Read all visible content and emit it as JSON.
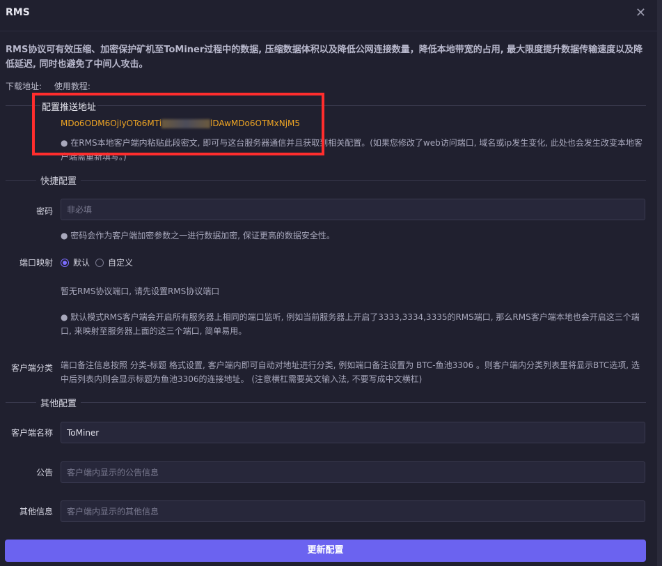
{
  "header": {
    "title": "RMS",
    "close_icon": "close-icon"
  },
  "description": "RMS协议可有效压缩、加密保护矿机至ToMiner过程中的数据, 压缩数据体积以及降低公网连接数量，降低本地带宽的占用, 最大限度提升数据传输速度以及降低延迟, 同时也避免了中间人攻击。",
  "links": {
    "download": "下载地址:",
    "tutorial": "使用教程:"
  },
  "push": {
    "title": "配置推送地址",
    "address_start": "MDo6ODM6OjIyOTo6MTi",
    "address_end": "lDAwMDo6OTMxNjM5",
    "note": "● 在RMS本地客户端内粘贴此段密文, 即可与这台服务器通信并且获取到相关配置。(如果您修改了web访问端口, 域名或ip发生变化, 此处也会发生改变本地客户端需重新填写。)"
  },
  "quick": {
    "title": "快捷配置",
    "password_label": "密码",
    "password_placeholder": "非必填",
    "password_note": "● 密码会作为客户端加密参数之一进行数据加密, 保证更高的数据安全性。",
    "port_label": "端口映射",
    "port_options": [
      "默认",
      "自定义"
    ],
    "port_empty": "暂无RMS协议端口, 请先设置RMS协议端口",
    "port_note": "● 默认模式RMS客户端会开启所有服务器上相同的端口监听, 例如当前服务器上开启了3333,3334,3335的RMS端口, 那么RMS客户端本地也会开启这三个端口, 来映射至服务器上面的这三个端口, 简单易用。",
    "client_category_label": "客户端分类",
    "client_category_note": "端口备注信息按照 分类-标题 格式设置, 客户端内即可自动对地址进行分类, 例如端口备注设置为 BTC-鱼池3306 。则客户端内分类列表里将显示BTC选项, 选中后列表内则会显示标题为鱼池3306的连接地址。 (注意横杠需要英文输入法, 不要写成中文横杠)"
  },
  "other": {
    "title": "其他配置",
    "client_name_label": "客户端名称",
    "client_name_value": "ToMiner",
    "notice_label": "公告",
    "notice_placeholder": "客户端内显示的公告信息",
    "other_label": "其他信息",
    "other_placeholder": "客户端内显示的其他信息"
  },
  "submit_label": "更新配置",
  "colors": {
    "accent": "#6b63f0",
    "address": "#f0a624",
    "highlight_box": "#ff2d2d"
  }
}
